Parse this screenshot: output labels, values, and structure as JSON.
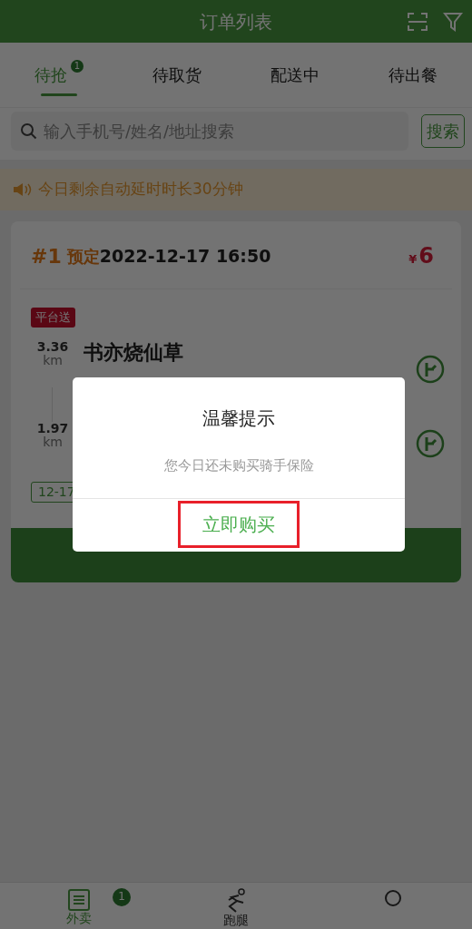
{
  "header": {
    "title": "订单列表"
  },
  "tabs": [
    {
      "label": "待抢",
      "badge": "1",
      "selected": true
    },
    {
      "label": "待取货",
      "selected": false
    },
    {
      "label": "配送中",
      "selected": false
    },
    {
      "label": "待出餐",
      "selected": false
    }
  ],
  "search": {
    "placeholder": "输入手机号/姓名/地址搜索",
    "button": "搜索"
  },
  "notice": "今日剩余自动延时时长30分钟",
  "order": {
    "number": "#1",
    "type": "预定",
    "time": "2022-12-17 16:50",
    "currency": "¥",
    "price": "6",
    "tag": "平台送",
    "stops": [
      {
        "distance": "3.36",
        "unit": "km",
        "name": "书亦烧仙草"
      },
      {
        "distance": "1.97",
        "unit": "km"
      }
    ],
    "date_tag": "12-17"
  },
  "dialog": {
    "title": "温馨提示",
    "message": "您今日还未购买骑手保险",
    "button": "立即购买"
  },
  "bottom_nav": [
    {
      "label": "外卖",
      "badge": "1",
      "selected": true,
      "kind": "list"
    },
    {
      "label": "跑腿",
      "selected": false,
      "kind": "runner"
    },
    {
      "selected": false,
      "kind": "circle"
    }
  ]
}
